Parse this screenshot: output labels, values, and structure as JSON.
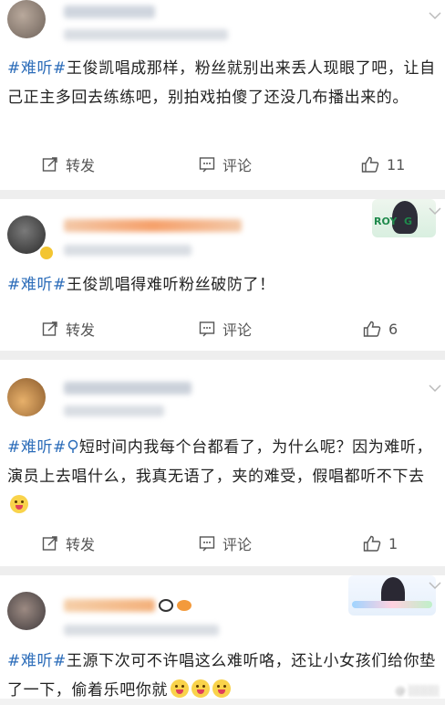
{
  "posts": [
    {
      "tag": "#难听#",
      "text": "王俊凯唱成那样，粉丝就别出来丢人现眼了吧，让自己正主多回去练练吧，别拍戏拍傻了还没几布播出来的。",
      "repost_label": "转发",
      "comment_label": "评论",
      "likes": "11"
    },
    {
      "tag": "#难听#",
      "text": "王俊凯唱得难听粉丝破防了！",
      "repost_label": "转发",
      "comment_label": "评论",
      "likes": "6",
      "badge_text": "ROY  G"
    },
    {
      "tag": "#难听#",
      "text": "短时间内我每个台都看了，为什么呢？因为难听，演员上去唱什么，我真无语了，夹的难受，假唱都听不下去",
      "repost_label": "转发",
      "comment_label": "评论",
      "likes": "1"
    },
    {
      "tag": "#难听#",
      "text": "王源下次可不许唱这么难听咯，还让小女孩们给你垫了一下，偷着乐吧你就"
    }
  ],
  "colors": {
    "tag": "#2b6cb9",
    "text": "#222222",
    "action": "#555555",
    "separator": "#eeeeee"
  }
}
